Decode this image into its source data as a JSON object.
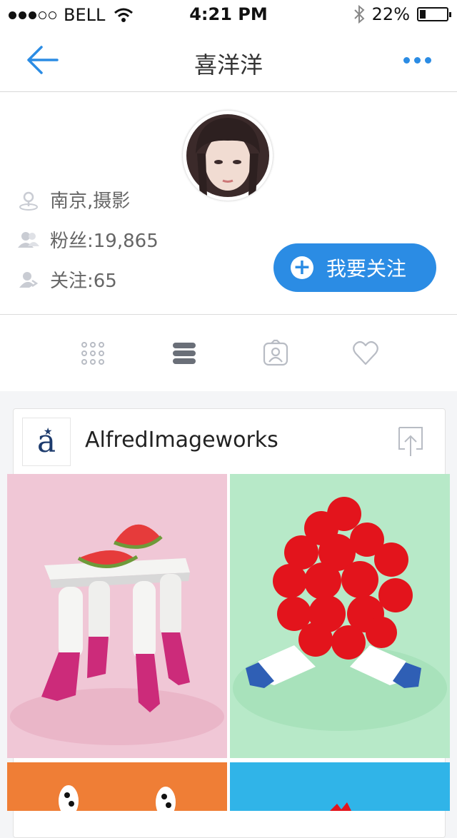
{
  "status": {
    "carrier": "BELL",
    "time": "4:21 PM",
    "battery": "22%"
  },
  "nav": {
    "title": "喜洋洋"
  },
  "profile": {
    "location": "南京,摄影",
    "fans": "粉丝:19,865",
    "following": "关注:65",
    "follow_button": "我要关注"
  },
  "card": {
    "brand_name": "AlfredImageworks",
    "brand_letter": "a"
  },
  "colors": {
    "accent": "#2b8ce4"
  }
}
